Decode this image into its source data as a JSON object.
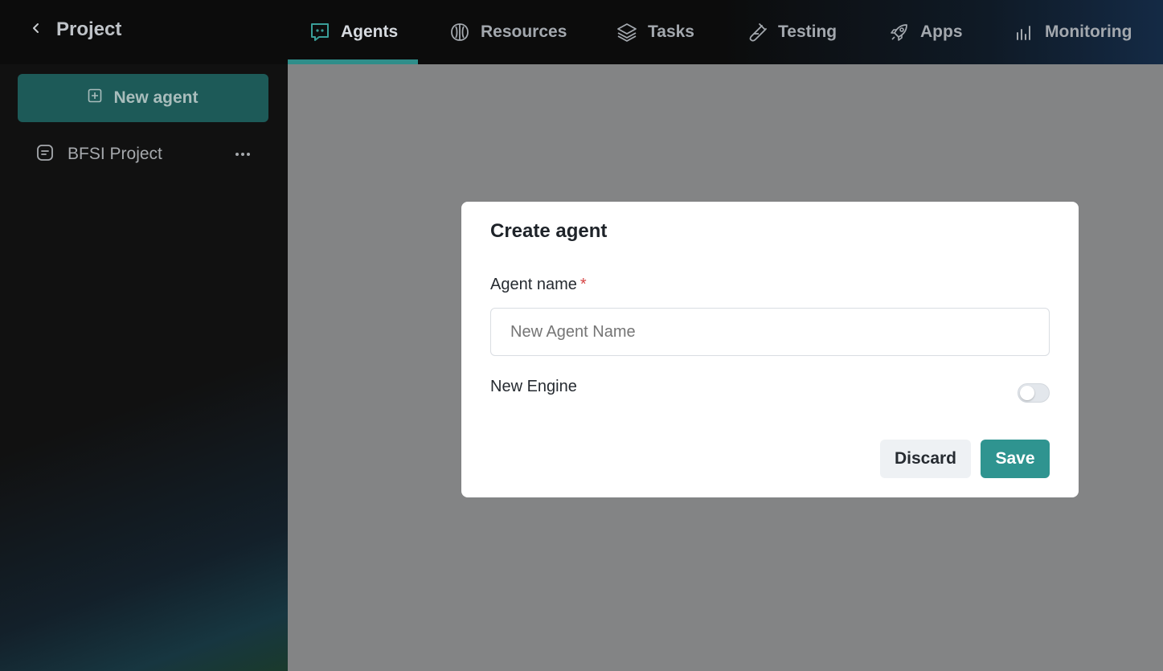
{
  "header": {
    "back_icon": "chevron-left-icon",
    "project_title": "Project",
    "tabs": [
      {
        "label": "Agents",
        "icon": "chat-bubble-icon",
        "active": true
      },
      {
        "label": "Resources",
        "icon": "brain-icon",
        "active": false
      },
      {
        "label": "Tasks",
        "icon": "layers-icon",
        "active": false
      },
      {
        "label": "Testing",
        "icon": "test-tube-icon",
        "active": false
      },
      {
        "label": "Apps",
        "icon": "rocket-icon",
        "active": false
      },
      {
        "label": "Monitoring",
        "icon": "bar-chart-icon",
        "active": false
      }
    ]
  },
  "sidebar": {
    "new_agent_label": "New agent",
    "items": [
      {
        "label": "BFSI Project",
        "icon": "document-icon"
      }
    ]
  },
  "modal": {
    "title": "Create agent",
    "agent_name_label": "Agent name",
    "required_mark": "*",
    "agent_name_placeholder": "New Agent Name",
    "agent_name_value": "",
    "new_engine_label": "New Engine",
    "new_engine_enabled": false,
    "discard_label": "Discard",
    "save_label": "Save"
  },
  "colors": {
    "accent": "#2f9490",
    "new_agent_button": "#1d5a58",
    "overlay": "#838485",
    "required": "#d64545"
  }
}
